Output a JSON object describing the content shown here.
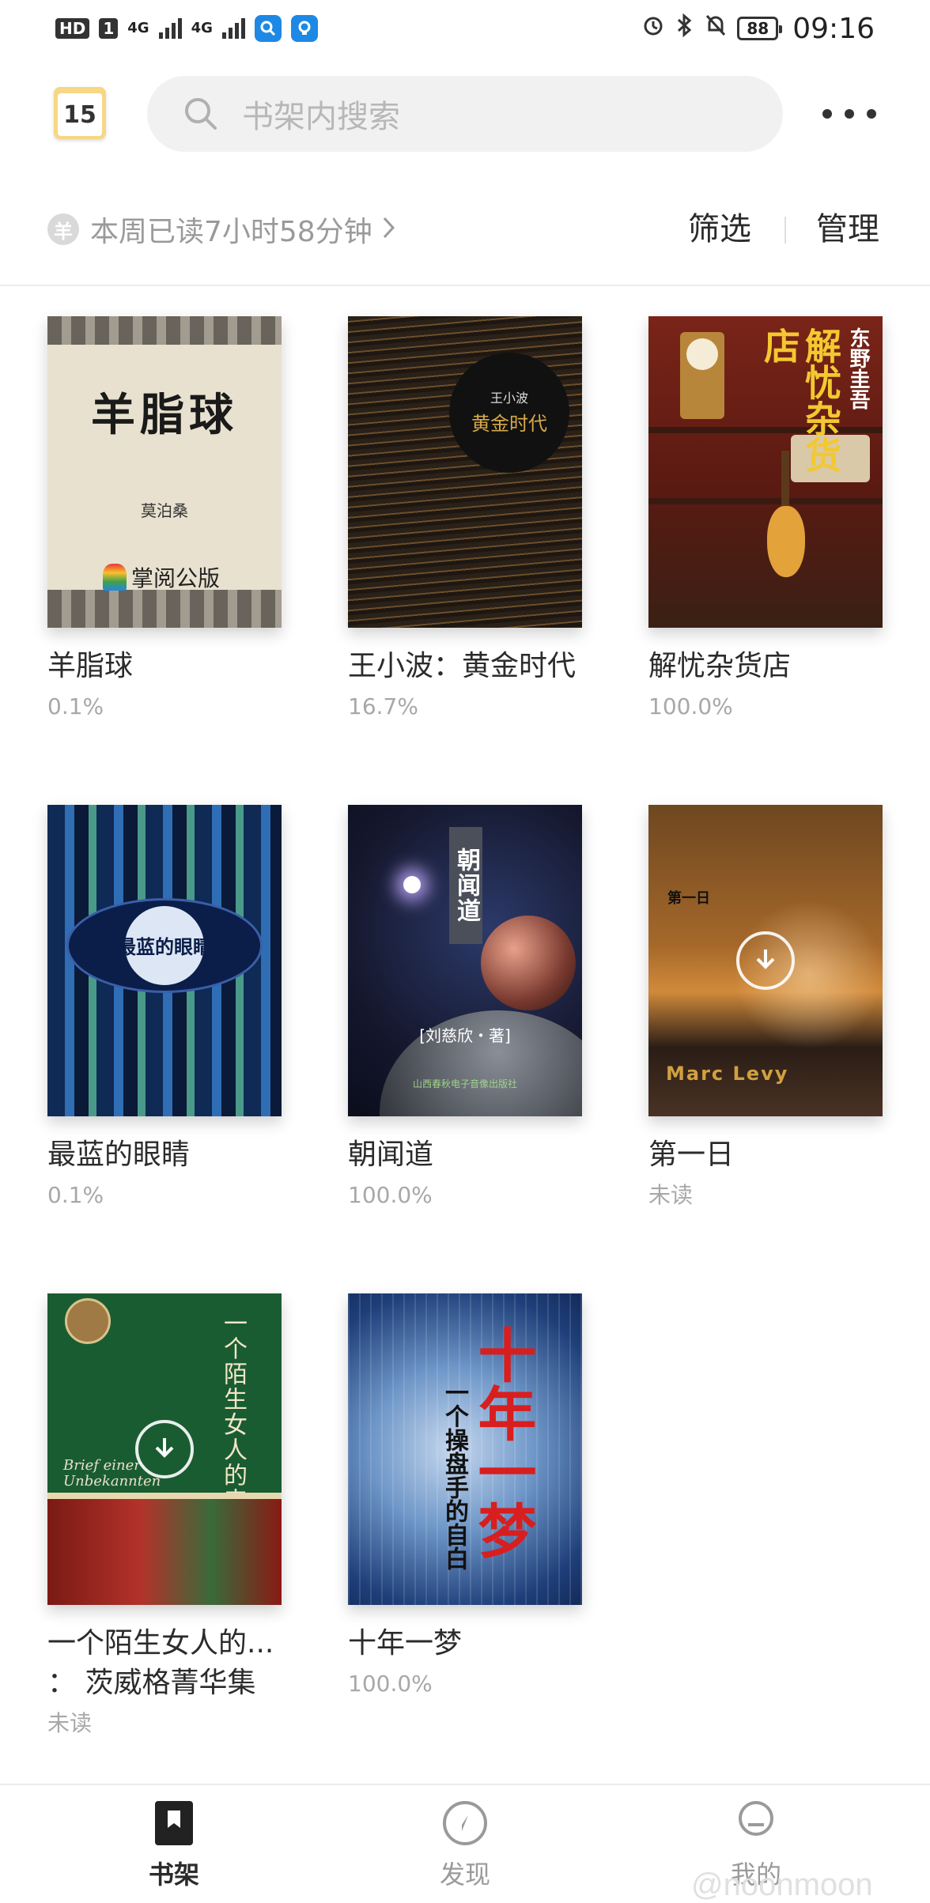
{
  "status_bar": {
    "hd_tags": [
      "HD",
      "1"
    ],
    "network_labels": [
      "4G",
      "4G"
    ],
    "battery": "88",
    "time": "09:16",
    "icons": [
      "alarm-icon",
      "bluetooth-icon",
      "mute-icon",
      "battery-icon"
    ]
  },
  "header": {
    "calendar_day": "15",
    "search_placeholder": "书架内搜索"
  },
  "stat": {
    "coin_symbol": "羊",
    "weekly_reading": "本周已读7小时58分钟"
  },
  "toolbar": {
    "filter_label": "筛选",
    "manage_label": "管理"
  },
  "books": [
    {
      "title": "羊脂球",
      "progress": "0.1%",
      "cover_title": "羊脂球",
      "cover_author": "莫泊桑",
      "cover_publisher": "掌阅公版"
    },
    {
      "title": "王小波：黄金时代",
      "progress": "16.7%",
      "cover_author": "王小波",
      "cover_title": "黄金时代"
    },
    {
      "title": "解忧杂货店",
      "progress": "100.0%",
      "cover_author": "东野圭吾",
      "cover_title": "解忧杂货店"
    },
    {
      "title": "最蓝的眼睛",
      "progress": "0.1%",
      "cover_title": "最蓝的眼睛"
    },
    {
      "title": "朝闻道",
      "progress": "100.0%",
      "cover_title": "朝闻道",
      "cover_author": "[刘慈欣・著]",
      "cover_publisher": "山西春秋电子音像出版社"
    },
    {
      "title": "第一日",
      "progress": "未读",
      "cover_title": "第一日",
      "cover_author": "Marc Levy"
    },
    {
      "title_line1": "一个陌生女人的...",
      "title_line2": "：  茨威格菁华集",
      "progress": "未读",
      "cover_title": "一个陌生女人的来信",
      "cover_subtitle": "Brief einer Unbekannten"
    },
    {
      "title": "十年一梦",
      "progress": "100.0%",
      "cover_title": "十年一梦",
      "cover_subtitle": "一个操盘手的自白"
    }
  ],
  "bottom_nav": [
    {
      "label": "书架",
      "icon": "bookshelf-icon",
      "active": true
    },
    {
      "label": "发现",
      "icon": "compass-icon",
      "active": false
    },
    {
      "label": "我的",
      "icon": "profile-icon",
      "active": false
    }
  ],
  "watermark": "@noonmoon",
  "colors": {
    "text_primary": "#2b2b2b",
    "text_secondary": "#a8a8a8",
    "search_bg": "#f1f1f1",
    "calendar_accent": "#f6d783"
  }
}
